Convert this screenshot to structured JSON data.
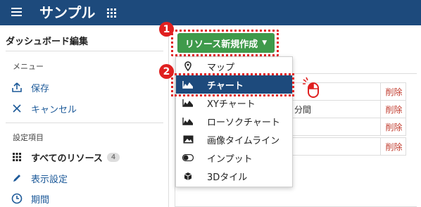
{
  "header": {
    "title": "サンプル",
    "menu_icon": "hamburger-icon",
    "apps_icon": "grid-icon",
    "bg_color": "#1d4a7c"
  },
  "sidebar": {
    "title": "ダッシュボード編集",
    "menu_section": "メニュー",
    "save_label": "保存",
    "cancel_label": "キャンセル",
    "settings_section": "設定項目",
    "all_resources_label": "すべてのリソース",
    "all_resources_count": "4",
    "display_settings_label": "表示設定",
    "period_label": "期間"
  },
  "main": {
    "create_button_label": "リソース新規作成",
    "table_rows": [
      {
        "text": "",
        "delete": "削除"
      },
      {
        "text": "分間",
        "delete": "削除"
      },
      {
        "text": "",
        "delete": "削除"
      },
      {
        "text": "",
        "delete": "削除"
      }
    ]
  },
  "dropdown": {
    "items": [
      {
        "label": "マップ",
        "icon": "map-pin-icon"
      },
      {
        "label": "チャート",
        "icon": "area-chart-icon",
        "active": true
      },
      {
        "label": "XYチャート",
        "icon": "area-chart-icon"
      },
      {
        "label": "ローソクチャート",
        "icon": "area-chart-icon"
      },
      {
        "label": "画像タイムライン",
        "icon": "image-icon"
      },
      {
        "label": "インプット",
        "icon": "toggle-icon"
      },
      {
        "label": "3Dタイル",
        "icon": "cube-icon"
      }
    ]
  },
  "annotations": {
    "step1": "1",
    "step2": "2",
    "highlight_color": "#e02020"
  }
}
